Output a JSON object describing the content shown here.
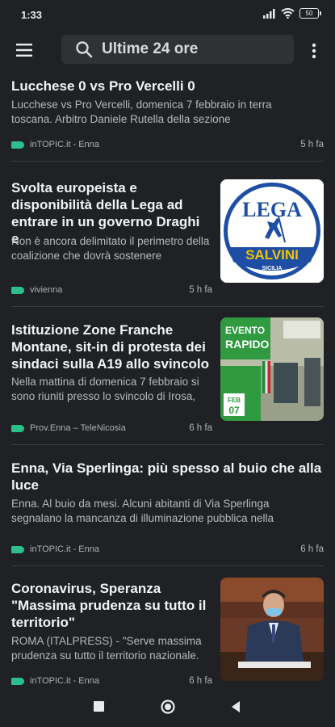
{
  "status": {
    "time": "1:33",
    "battery": "50"
  },
  "search": {
    "query": "Ultime 24 ore"
  },
  "articles": [
    {
      "title": "Lucchese 0 vs Pro Vercelli 0",
      "snippet": "Lucchese vs Pro Vercelli, domenica 7 febbraio in terra toscana. Arbitro Daniele Rutella della sezione",
      "source": "inTOPIC.it - Enna",
      "time": "5 h fa"
    },
    {
      "title": "Svolta europeista e disponibilità della Lega ad entrare in un governo Draghi e",
      "snippet": "Non è ancora delimitato il perimetro della coalizione che dovrà sostenere",
      "source": "vivienna",
      "time": "5 h fa",
      "image": {
        "logo_top": "LEGA",
        "logo_band": "SALVINI",
        "logo_bottom": "SICILIA"
      }
    },
    {
      "title": "Istituzione Zone Franche Montane, sit-in di protesta dei sindaci sulla A19 allo svincolo",
      "snippet": "Nella mattina di domenica 7 febbraio si sono riuniti presso lo svincolo di Irosa,",
      "source": "Prov.Enna – TeleNicosia",
      "time": "6 h fa",
      "image": {
        "overlay_line1": "EVENTO",
        "overlay_line2": "RAPIDO",
        "badge_month": "FEB",
        "badge_day": "07"
      }
    },
    {
      "title": "Enna, Via Sperlinga: più spesso al buio che alla luce",
      "snippet": "Enna. Al buio da mesi. Alcuni abitanti di Via Sperlinga segnalano la mancanza di illuminazione pubblica nella",
      "source": "inTOPIC.it - Enna",
      "time": "6 h fa"
    },
    {
      "title": "Coronavirus, Speranza \"Massima prudenza su tutto il territorio\"",
      "snippet": "ROMA (ITALPRESS) - \"Serve massima prudenza su tutto il territorio nazionale.",
      "source": "inTOPIC.it - Enna",
      "time": "6 h fa"
    }
  ],
  "colors": {
    "background": "#202124",
    "source_tag": "#2bbf8c",
    "search_bg": "#303134"
  }
}
